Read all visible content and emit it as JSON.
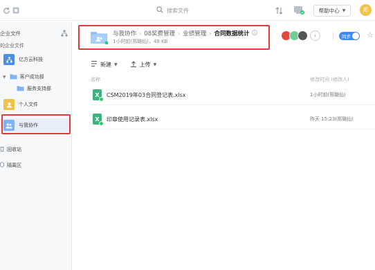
{
  "topbar": {
    "search_placeholder": "搜索文件",
    "help_label": "帮助中心",
    "user_avatar_text": "郑"
  },
  "sidebar": {
    "section_title": "企业文件",
    "section_subtitle": "的企业文件",
    "items": [
      {
        "label": "亿方云科技"
      },
      {
        "label": "客户成功部"
      },
      {
        "label": "服务支持部"
      },
      {
        "label": "个人文件"
      },
      {
        "label": "与我协作"
      },
      {
        "label": "回收站"
      },
      {
        "label": "隔离区"
      }
    ]
  },
  "folder": {
    "breadcrumb": [
      "与我协作",
      "08奖费管理",
      "业绩管理",
      "合同数据统计"
    ],
    "meta": "1小时前(郑璐仙)，48 KB",
    "sync_label": "同步"
  },
  "toolbar": {
    "new_label": "新建",
    "upload_label": "上传"
  },
  "table": {
    "col_name": "名称",
    "col_modified": "修改时间 (修改人)",
    "rows": [
      {
        "name": "CSM2019年03合同登记表.xlsx",
        "modified": "1小时前(郑璐仙)"
      },
      {
        "name": "印章使用记录表.xlsx",
        "modified": "昨天 15:23(郑璐仙)"
      }
    ]
  },
  "colors": {
    "accent": "#3d8af7",
    "highlight_box": "#e03a3a",
    "excel_green": "#3fb27f",
    "avatar_yellow": "#f0c24b"
  }
}
